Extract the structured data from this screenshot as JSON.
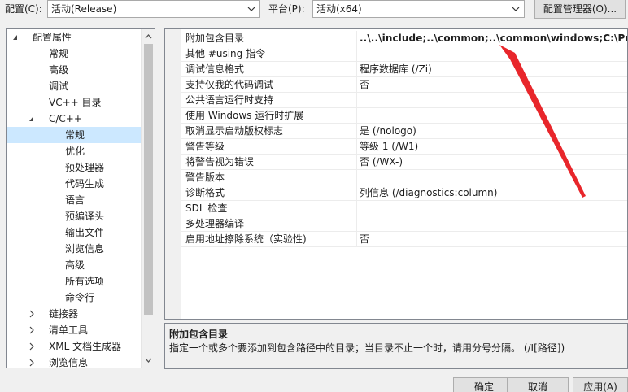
{
  "toolbar": {
    "config_label": "配置(C):",
    "config_value": "活动(Release)",
    "platform_label": "平台(P):",
    "platform_value": "活动(x64)",
    "config_manager_button": "配置管理器(O)..."
  },
  "tree": {
    "items": [
      {
        "label": "配置属性",
        "level": 0,
        "expanded": true
      },
      {
        "label": "常规",
        "level": 1
      },
      {
        "label": "高级",
        "level": 1
      },
      {
        "label": "调试",
        "level": 1
      },
      {
        "label": "VC++ 目录",
        "level": 1
      },
      {
        "label": "C/C++",
        "level": 1,
        "expanded": true
      },
      {
        "label": "常规",
        "level": 2,
        "selected": true
      },
      {
        "label": "优化",
        "level": 2
      },
      {
        "label": "预处理器",
        "level": 2
      },
      {
        "label": "代码生成",
        "level": 2
      },
      {
        "label": "语言",
        "level": 2
      },
      {
        "label": "预编译头",
        "level": 2
      },
      {
        "label": "输出文件",
        "level": 2
      },
      {
        "label": "浏览信息",
        "level": 2
      },
      {
        "label": "高级",
        "level": 2
      },
      {
        "label": "所有选项",
        "level": 2
      },
      {
        "label": "命令行",
        "level": 2
      },
      {
        "label": "链接器",
        "level": 1,
        "collapsed": true
      },
      {
        "label": "清单工具",
        "level": 1,
        "collapsed": true
      },
      {
        "label": "XML 文档生成器",
        "level": 1,
        "collapsed": true
      },
      {
        "label": "浏览信息",
        "level": 1,
        "collapsed": true
      }
    ]
  },
  "properties": [
    {
      "name": "附加包含目录",
      "value": "..\\..\\include;..\\common;..\\common\\windows;C:\\Progra"
    },
    {
      "name": "其他 #using 指令",
      "value": ""
    },
    {
      "name": "调试信息格式",
      "value": "程序数据库 (/Zi)"
    },
    {
      "name": "支持仅我的代码调试",
      "value": "否"
    },
    {
      "name": "公共语言运行时支持",
      "value": ""
    },
    {
      "name": "使用 Windows 运行时扩展",
      "value": ""
    },
    {
      "name": "取消显示启动版权标志",
      "value": "是 (/nologo)"
    },
    {
      "name": "警告等级",
      "value": "等级 1 (/W1)"
    },
    {
      "name": "将警告视为错误",
      "value": "否 (/WX-)"
    },
    {
      "name": "警告版本",
      "value": ""
    },
    {
      "name": "诊断格式",
      "value": "列信息 (/diagnostics:column)"
    },
    {
      "name": "SDL 检查",
      "value": ""
    },
    {
      "name": "多处理器编译",
      "value": ""
    },
    {
      "name": "启用地址擦除系统（实验性)",
      "value": "否"
    }
  ],
  "description": {
    "title": "附加包含目录",
    "text": "指定一个或多个要添加到包含路径中的目录；当目录不止一个时，请用分号分隔。     (/I[路径])"
  },
  "buttons": {
    "ok": "确定",
    "cancel": "取消",
    "apply": "应用(A)"
  },
  "colors": {
    "selection": "#cce8ff",
    "annotation_arrow": "#e8262b"
  }
}
